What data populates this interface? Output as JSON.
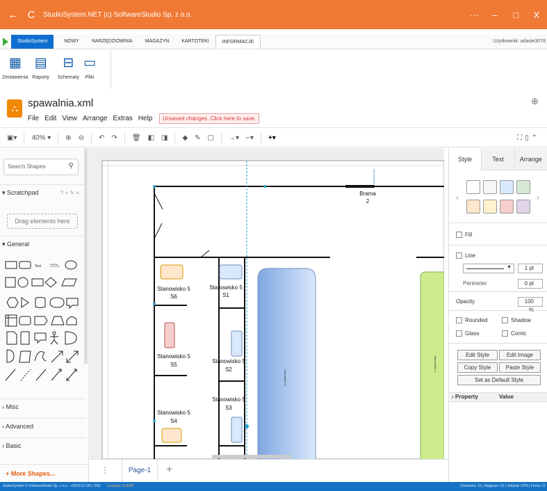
{
  "window": {
    "title": "StudioSystem.NET (c) SoftwareStudio Sp. z o.o.",
    "back": "←",
    "refresh": "C",
    "more": "···",
    "minimize": "–",
    "maximize": "□",
    "close": "X"
  },
  "menubar": {
    "app": "StudioSystem",
    "tabs": [
      "NOWY",
      "NARZĘDZIOWNIA",
      "MAGAZYN",
      "KARTOTEKI",
      "INFORMACJE"
    ],
    "active": "INFORMACJE",
    "user": "Użytkownik: adasie3078"
  },
  "ribbon": [
    {
      "label": "Zestawienia",
      "icon": "grid-icon",
      "glyph": "▦"
    },
    {
      "label": "Raporty",
      "icon": "reports-icon",
      "glyph": "▤"
    },
    {
      "label": "Schematy",
      "icon": "schema-icon",
      "glyph": "⊟"
    },
    {
      "label": "Pliki",
      "icon": "folder-icon",
      "glyph": "▭"
    }
  ],
  "doc": {
    "filename": "spawalnia.xml",
    "menu": [
      "File",
      "Edit",
      "View",
      "Arrange",
      "Extras",
      "Help"
    ],
    "unsaved": "Unsaved changes. Click here to save."
  },
  "toolbar": {
    "zoom": "40%"
  },
  "left": {
    "search_placeholder": "Search Shapes",
    "scratchpad": "Scratchpad",
    "scratch_tools": "? + ✎ ×",
    "drag": "Drag elements here",
    "general": "General",
    "sections": [
      "Misc",
      "Advanced",
      "Basic"
    ],
    "more": "+ More Shapes...",
    "text_shape": "Text",
    "heading_shape": "Heading"
  },
  "canvas": {
    "gate_label": "Brama",
    "gate_num": "2",
    "stations": [
      {
        "l1": "Stanowisko 5",
        "l2": "S6"
      },
      {
        "l1": "Stanowisko 5",
        "l2": "S1"
      },
      {
        "l1": "Stanowisko 5",
        "l2": "S5"
      },
      {
        "l1": "Stanowisko 5",
        "l2": "S2"
      },
      {
        "l1": "Stanowisko 5",
        "l2": "S3"
      },
      {
        "l1": "Stanowisko 5",
        "l2": "S4"
      }
    ],
    "blue_vertical": "Stanowisko 5",
    "green_vertical": "Stanowisko 4"
  },
  "pages": {
    "tab": "Page-1"
  },
  "right": {
    "tabs": [
      "Style",
      "Text",
      "Arrange"
    ],
    "fill": "Fill",
    "line": "Line",
    "line_width": "1 pt",
    "perimeter": "Perimeter",
    "perimeter_val": "0 pt",
    "opacity": "Opacity",
    "opacity_val": "100 %",
    "rounded": "Rounded",
    "shadow": "Shadow",
    "glass": "Glass",
    "comic": "Comic",
    "edit_style": "Edit Style",
    "edit_image": "Edit Image",
    "copy_style": "Copy Style",
    "paste_style": "Paste Style",
    "default_style": "Set as Default Style",
    "property": "Property",
    "value": "Value",
    "swatches": [
      "#ffffff",
      "#f5f5f5",
      "#dae8fc",
      "#d5e8d4",
      "#ffe6cc",
      "#fff2cc",
      "#f8cecc",
      "#e1d5e7"
    ]
  },
  "status": {
    "left": "StudioSystem © SoftwareStudio Sp. z o.o. - v2019.12.351.7291",
    "license": "Licencja: CLIENT",
    "right": "| Komórka: 01 | Magazyn: 01 | Oddział: CPN | Firma: 01"
  }
}
